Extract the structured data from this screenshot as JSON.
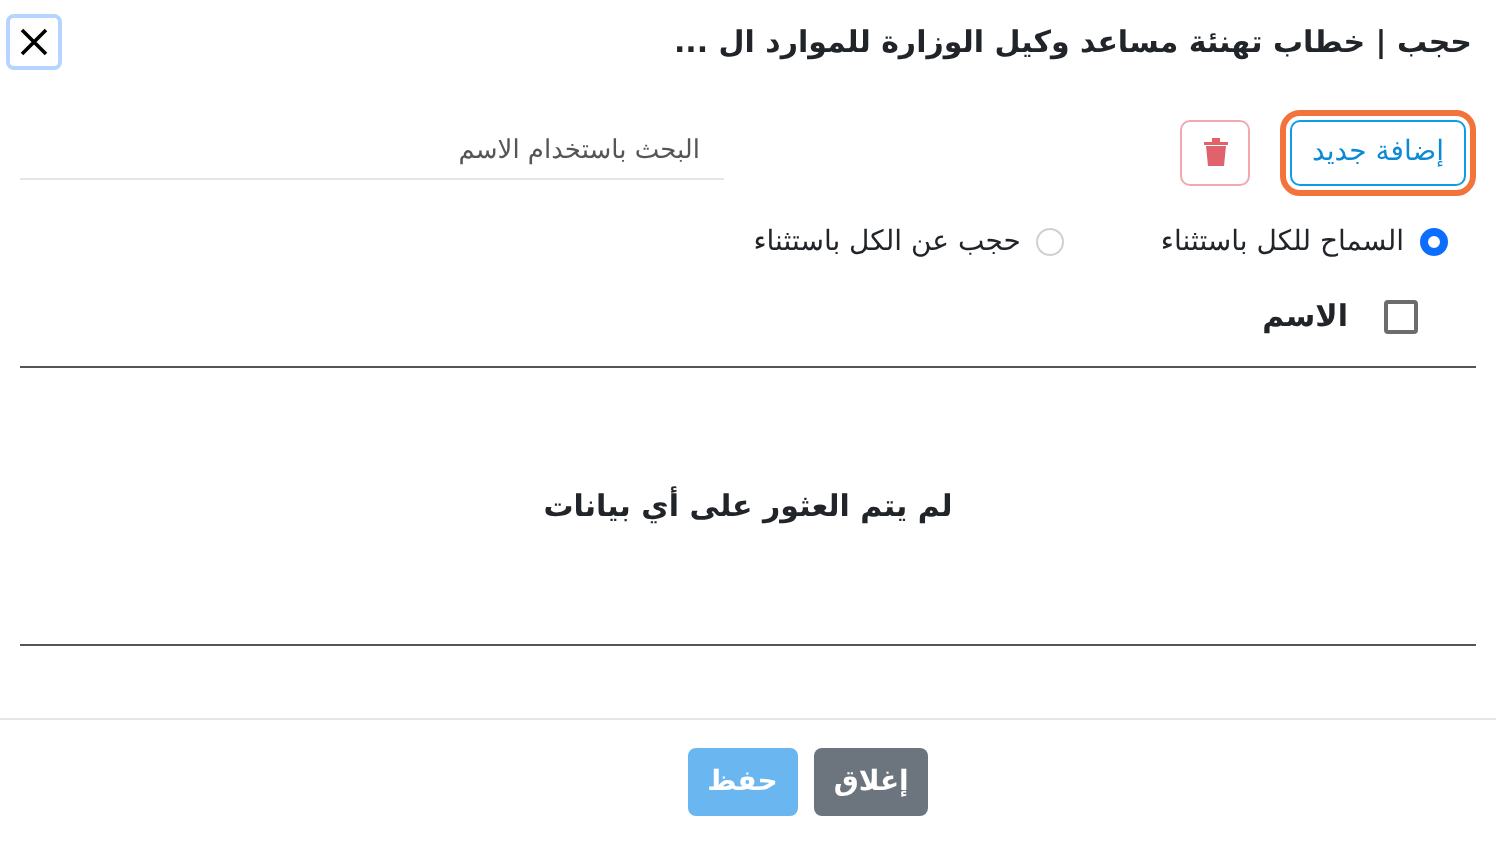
{
  "dialog": {
    "title": "حجب | خطاب تهنئة مساعد وكيل الوزارة للموارد ال ..."
  },
  "toolbar": {
    "add_button": "إضافة جديد",
    "search": {
      "placeholder": "البحث باستخدام الاسم"
    }
  },
  "mode_options": [
    {
      "label": "السماح للكل باستثناء",
      "selected": true
    },
    {
      "label": "حجب عن الكل باستثناء",
      "selected": false
    }
  ],
  "table": {
    "select_all": {
      "checked": false
    },
    "columns": [
      "الاسم"
    ],
    "empty_message": "لم يتم العثور على أي بيانات"
  },
  "footer": {
    "buttons": [
      {
        "label": "إغلاق",
        "kind": "secondary",
        "disabled": false
      },
      {
        "label": "حفظ",
        "kind": "primary",
        "disabled": true
      }
    ]
  }
}
